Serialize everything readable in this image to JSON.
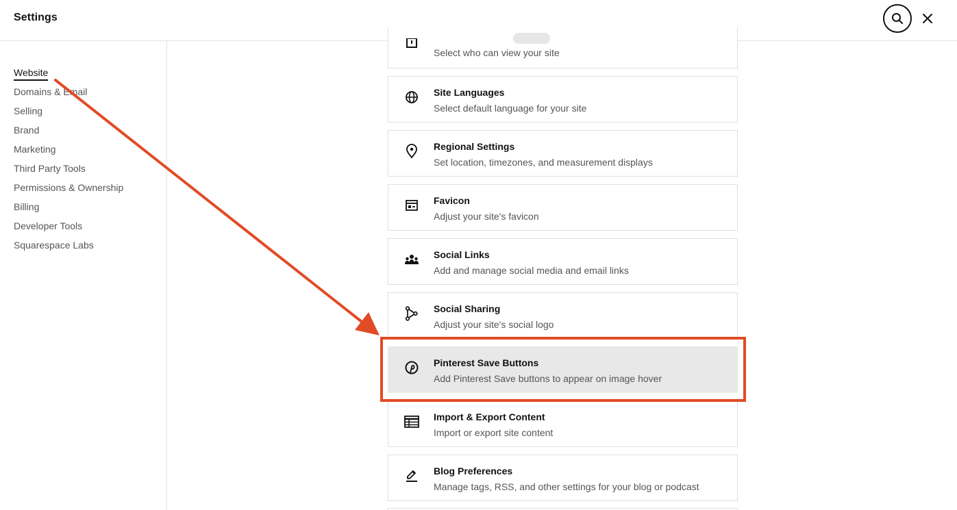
{
  "header": {
    "title": "Settings",
    "search_icon": "search-icon",
    "close_icon": "close-icon"
  },
  "sidebar": {
    "items": [
      {
        "label": "Website",
        "active": true
      },
      {
        "label": "Domains & Email",
        "active": false
      },
      {
        "label": "Selling",
        "active": false
      },
      {
        "label": "Brand",
        "active": false
      },
      {
        "label": "Marketing",
        "active": false
      },
      {
        "label": "Third Party Tools",
        "active": false
      },
      {
        "label": "Permissions & Ownership",
        "active": false
      },
      {
        "label": "Billing",
        "active": false
      },
      {
        "label": "Developer Tools",
        "active": false
      },
      {
        "label": "Squarespace Labs",
        "active": false
      }
    ]
  },
  "main": {
    "partial_card": {
      "icon": "lock-icon",
      "description": "Select who can view your site"
    },
    "cards": [
      {
        "icon": "globe-icon",
        "title": "Site Languages",
        "description": "Select default language for your site"
      },
      {
        "icon": "location-pin-icon",
        "title": "Regional Settings",
        "description": "Set location, timezones, and measurement displays"
      },
      {
        "icon": "favicon-icon",
        "title": "Favicon",
        "description": "Adjust your site's favicon"
      },
      {
        "icon": "people-icon",
        "title": "Social Links",
        "description": "Add and manage social media and email links"
      },
      {
        "icon": "share-icon",
        "title": "Social Sharing",
        "description": "Adjust your site's social logo"
      },
      {
        "icon": "pinterest-icon",
        "title": "Pinterest Save Buttons",
        "description": "Add Pinterest Save buttons to appear on image hover",
        "highlighted": true
      },
      {
        "icon": "table-icon",
        "title": "Import & Export Content",
        "description": "Import or export site content"
      },
      {
        "icon": "edit-icon",
        "title": "Blog Preferences",
        "description": "Manage tags, RSS, and other settings for your blog or podcast"
      }
    ]
  },
  "colors": {
    "annotation": "#e14b25",
    "highlight_bg": "#e8e8e8",
    "border": "#dedede"
  }
}
